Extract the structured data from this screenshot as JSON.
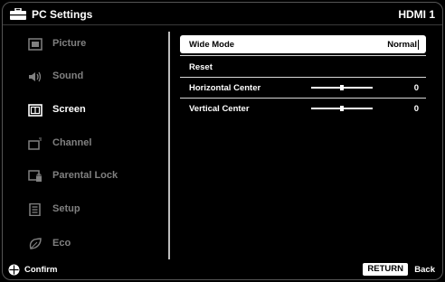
{
  "header": {
    "title": "PC Settings",
    "input": "HDMI 1"
  },
  "sidebar": {
    "items": [
      {
        "label": "Picture",
        "icon": "picture-icon",
        "active": false
      },
      {
        "label": "Sound",
        "icon": "speaker-icon",
        "active": false
      },
      {
        "label": "Screen",
        "icon": "screen-icon",
        "active": true
      },
      {
        "label": "Channel",
        "icon": "channel-icon",
        "active": false
      },
      {
        "label": "Parental Lock",
        "icon": "lock-icon",
        "active": false
      },
      {
        "label": "Setup",
        "icon": "setup-icon",
        "active": false
      },
      {
        "label": "Eco",
        "icon": "eco-icon",
        "active": false
      }
    ]
  },
  "menu": {
    "wide_mode": {
      "label": "Wide Mode",
      "value": "Normal"
    },
    "reset": {
      "label": "Reset"
    },
    "horizontal_center": {
      "label": "Horizontal Center",
      "value": "0",
      "position": 0.5
    },
    "vertical_center": {
      "label": "Vertical Center",
      "value": "0",
      "position": 0.5
    }
  },
  "footer": {
    "confirm": "Confirm",
    "return": "RETURN",
    "back": "Back"
  },
  "colors": {
    "background": "#000000",
    "selection": "#ffffff",
    "inactive_text": "#808080"
  }
}
